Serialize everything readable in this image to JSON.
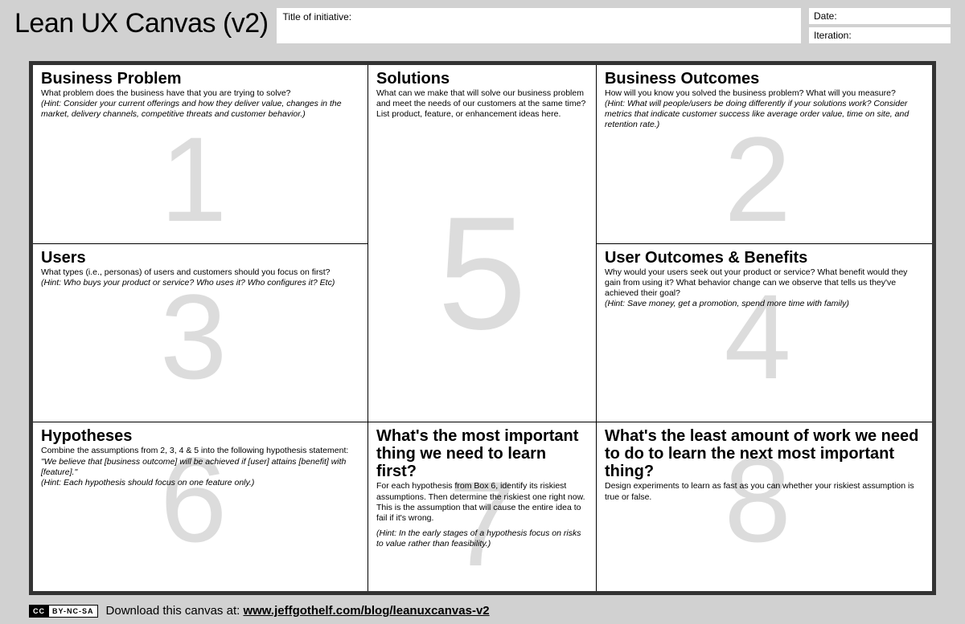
{
  "header": {
    "page_title": "Lean UX Canvas (v2)",
    "title_label": "Title of initiative:",
    "date_label": "Date:",
    "iteration_label": "Iteration:"
  },
  "boxes": {
    "b1": {
      "num": "1",
      "title": "Business Problem",
      "desc": "What problem does the business have that you are trying to solve?",
      "hint": "(Hint: Consider your current offerings and how they deliver value, changes in the market, delivery channels, competitive threats and customer behavior.)"
    },
    "b3": {
      "num": "3",
      "title": "Users",
      "desc": "What types (i.e., personas) of users and customers should you focus on first?",
      "hint": "(Hint: Who buys your product or service? Who uses it? Who configures it? Etc)"
    },
    "b5": {
      "num": "5",
      "title": "Solutions",
      "desc": "What can we make that will solve our business problem and meet the needs of our customers at the same time? List product, feature, or enhancement ideas here.",
      "hint": ""
    },
    "b2": {
      "num": "2",
      "title": "Business Outcomes",
      "desc": "How will you know you solved the business problem? What will you measure?",
      "hint": "(Hint: What will people/users be doing differently if your solutions work? Consider metrics that indicate customer success like average order value, time on site, and retention rate.)"
    },
    "b4": {
      "num": "4",
      "title": "User Outcomes & Benefits",
      "desc": "Why would your users seek out your product or service? What benefit would they gain from using it? What behavior change can we observe that tells us they've achieved their goal?",
      "hint": "(Hint: Save money, get a promotion, spend more time with family)"
    },
    "b6": {
      "num": "6",
      "title": "Hypotheses",
      "desc": "Combine the assumptions from 2, 3, 4 & 5 into the following hypothesis statement:",
      "quote": "\"We believe that [business outcome] will be achieved if [user] attains [benefit] with [feature].\"",
      "hint": "(Hint: Each hypothesis should focus on one feature only.)"
    },
    "b7": {
      "num": "7",
      "title": "What's the most important thing we need to learn first?",
      "desc": "For each hypothesis from Box 6, identify its riskiest assumptions. Then determine the riskiest one right now. This is the assumption that will cause the entire idea to fail if it's wrong.",
      "hint": "(Hint: In the early stages of a hypothesis focus on risks to value rather than feasibility.)"
    },
    "b8": {
      "num": "8",
      "title": "What's the least amount of work we need to do to learn the next most important thing?",
      "desc": "Design experiments to learn as fast as you can whether your riskiest assumption is true or false.",
      "hint": ""
    }
  },
  "footer": {
    "cc_left": "CC",
    "cc_right": "BY-NC-SA",
    "pre": "Download this canvas at: ",
    "link": "www.jeffgothelf.com/blog/leanuxcanvas-v2"
  }
}
